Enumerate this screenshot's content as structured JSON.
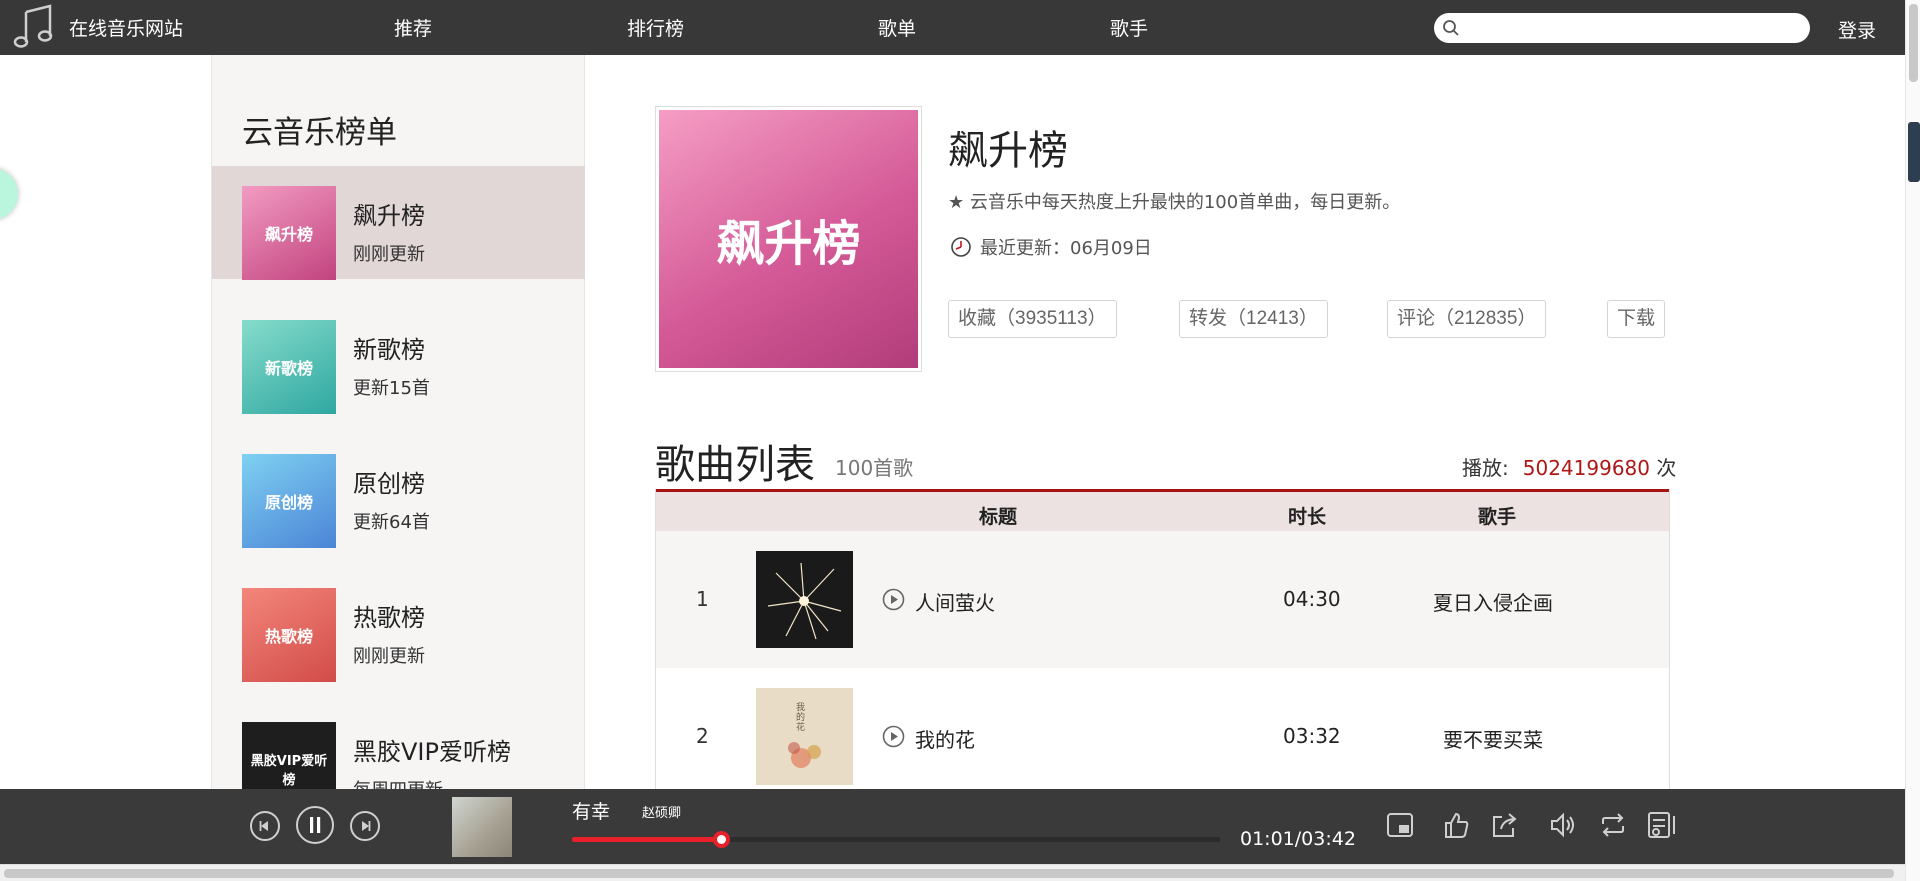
{
  "site": {
    "name": "在线音乐网站"
  },
  "nav": {
    "items": [
      "推荐",
      "排行榜",
      "歌单",
      "歌手"
    ],
    "login": "登录"
  },
  "search": {
    "value": "",
    "placeholder": ""
  },
  "sidebar": {
    "title": "云音乐榜单",
    "items": [
      {
        "name": "飙升榜",
        "sub": "刚刚更新",
        "cover_text": "飙升榜",
        "active": true
      },
      {
        "name": "新歌榜",
        "sub": "更新15首",
        "cover_text": "新歌榜"
      },
      {
        "name": "原创榜",
        "sub": "更新64首",
        "cover_text": "原创榜"
      },
      {
        "name": "热歌榜",
        "sub": "刚刚更新",
        "cover_text": "热歌榜"
      },
      {
        "name": "黑胶VIP爱听榜",
        "sub": "每周四更新",
        "cover_text": "黑胶VIP爱听榜"
      }
    ]
  },
  "playlist": {
    "cover_text": "飙升榜",
    "title": "飙升榜",
    "description": "★ 云音乐中每天热度上升最快的100首单曲，每日更新。",
    "update": "最近更新：06月09日",
    "actions": {
      "collect": "收藏（3935113）",
      "share": "转发（12413）",
      "comment": "评论（212835）",
      "download": "下载"
    }
  },
  "song_list": {
    "heading": "歌曲列表",
    "count": "100首歌",
    "play_label": "播放:",
    "play_count": "5024199680",
    "play_unit": "次",
    "columns": {
      "title": "标题",
      "duration": "时长",
      "artist": "歌手"
    },
    "rows": [
      {
        "index": "1",
        "name": "人间萤火",
        "duration": "04:30",
        "artist": "夏日入侵企画"
      },
      {
        "index": "2",
        "name": "我的花",
        "duration": "03:32",
        "artist": "要不要买菜"
      }
    ]
  },
  "player": {
    "title": "有幸",
    "artist": "赵硕卿",
    "time": "01:01/03:42",
    "progress": 0.23
  },
  "colors": {
    "accent": "#a41414",
    "progress": "#e8202a",
    "topbar": "#383838"
  },
  "icons": [
    "music-note-icon",
    "search-icon",
    "clock-icon",
    "play-circle-icon",
    "prev-icon",
    "pause-icon",
    "next-icon",
    "mini-player-icon",
    "like-icon",
    "share-icon",
    "volume-icon",
    "repeat-icon",
    "playlist-icon"
  ]
}
